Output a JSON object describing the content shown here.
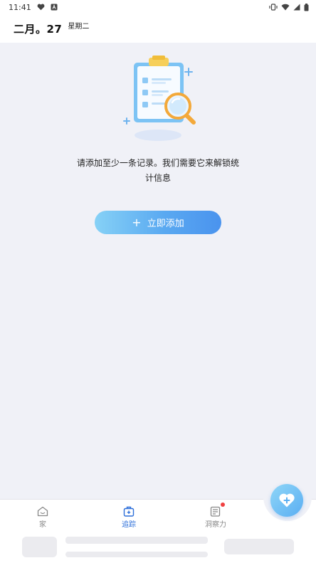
{
  "status_bar": {
    "time": "11:41",
    "left_icons": [
      "heart-icon",
      "a-icon"
    ],
    "right_icons": [
      "vibrate-icon",
      "wifi-icon",
      "signal-icon",
      "battery-icon"
    ]
  },
  "header": {
    "date": "二月。27",
    "weekday": "星期二"
  },
  "empty_state": {
    "illustration": "clipboard-magnifier-icon",
    "message_line1": "请添加至少一条记录。我们需要它来解锁统",
    "message_line2": "计信息",
    "add_button_plus": "+",
    "add_button_label": "立即添加"
  },
  "bottom_nav": {
    "items": [
      {
        "label": "家",
        "icon": "home-icon",
        "active": false
      },
      {
        "label": "追踪",
        "icon": "tracking-icon",
        "active": true
      },
      {
        "label": "洞察力",
        "icon": "insight-icon",
        "active": false,
        "badge": true
      }
    ]
  },
  "fab": {
    "icon": "heart-plus-icon"
  },
  "colors": {
    "background": "#f0f1f7",
    "accent": "#4a93ee",
    "accent_light": "#86d1f6",
    "active_nav": "#2d6fd9",
    "badge": "#f04040"
  }
}
